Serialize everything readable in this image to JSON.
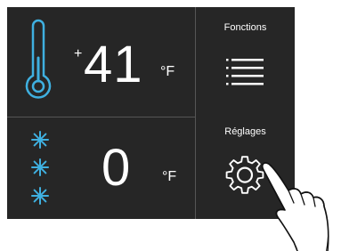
{
  "fridge": {
    "sign": "+",
    "value": "41",
    "unit": "°F",
    "icon": "thermometer-icon"
  },
  "freezer": {
    "value": "0",
    "unit": "°F",
    "icon": "snowflake-icon"
  },
  "functions": {
    "label": "Fonctions",
    "icon": "menu-lines-icon"
  },
  "settings": {
    "label": "Réglages",
    "icon": "gear-icon"
  },
  "colors": {
    "panel": "#262626",
    "text": "#ffffff",
    "accent": "#3fb0e0",
    "divider": "#555555"
  }
}
